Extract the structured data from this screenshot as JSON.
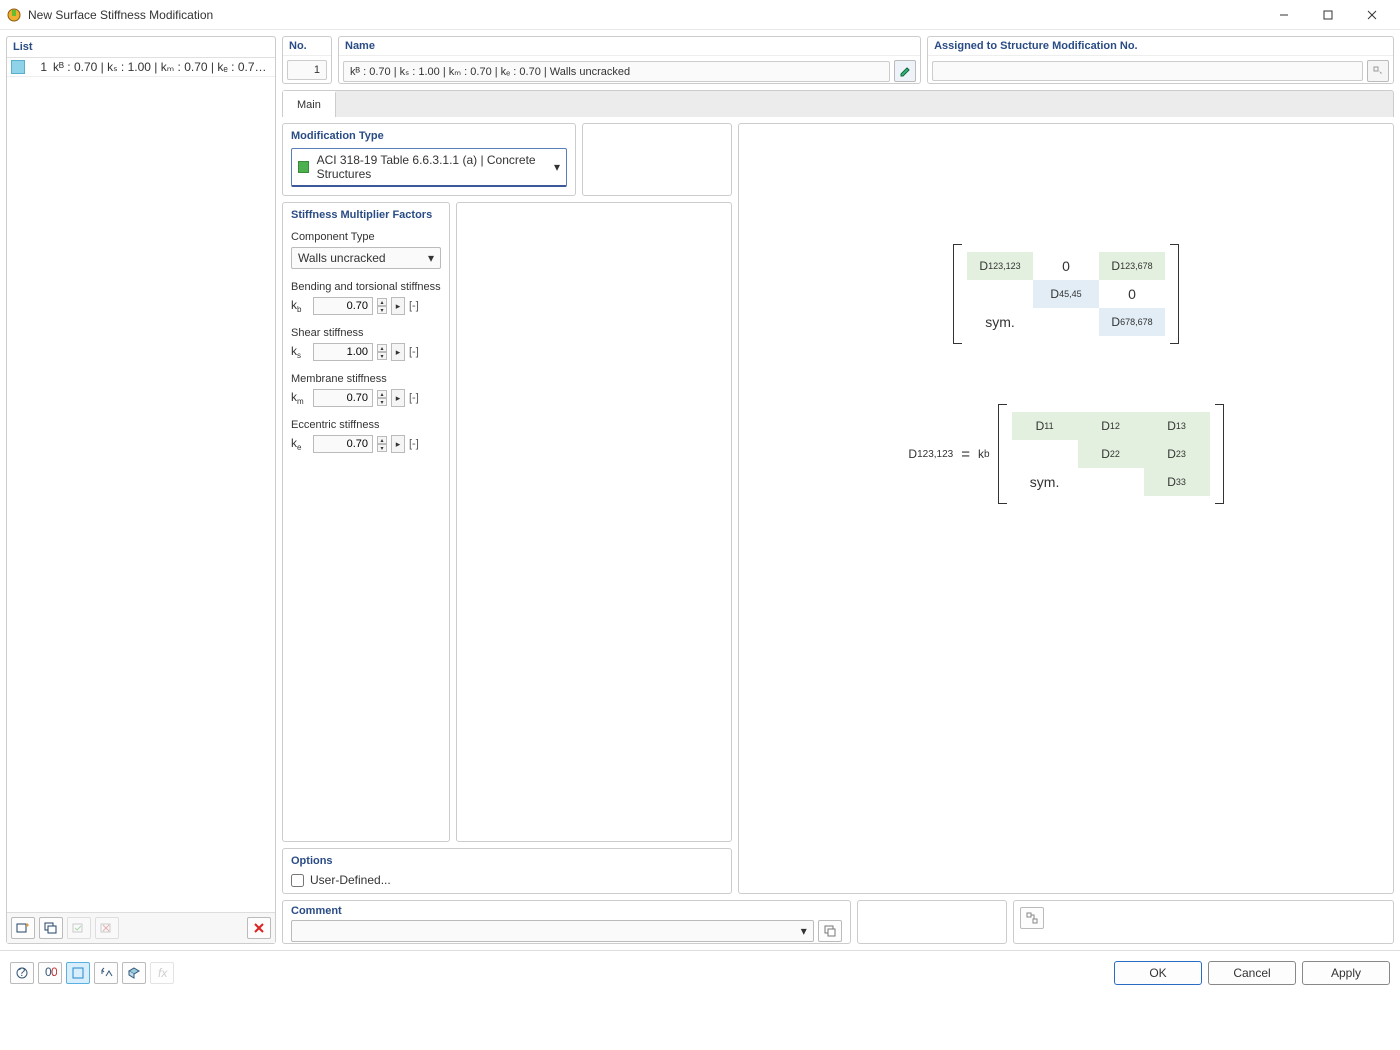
{
  "window": {
    "title": "New Surface Stiffness Modification"
  },
  "list": {
    "header": "List",
    "items": [
      {
        "num": "1",
        "text": "kᴮ : 0.70 | kₛ : 1.00 | kₘ : 0.70 | kₑ : 0.70 | Walls uncracked"
      }
    ]
  },
  "no": {
    "header": "No.",
    "value": "1"
  },
  "name": {
    "header": "Name",
    "value": "kᴮ : 0.70 | kₛ : 1.00 | kₘ : 0.70 | kₑ : 0.70 | Walls uncracked"
  },
  "assigned": {
    "header": "Assigned to Structure Modification No.",
    "value": ""
  },
  "tabs": {
    "main": "Main"
  },
  "modtype": {
    "header": "Modification Type",
    "value": "ACI 318-19 Table 6.6.3.1.1 (a) | Concrete Structures"
  },
  "factors": {
    "header": "Stiffness Multiplier Factors",
    "component_label": "Component Type",
    "component_value": "Walls uncracked",
    "bending_label": "Bending and torsional stiffness",
    "shear_label": "Shear stiffness",
    "membrane_label": "Membrane stiffness",
    "eccentric_label": "Eccentric stiffness",
    "kb_sym": "k",
    "kb_sub": "b",
    "kb_val": "0.70",
    "ks_sym": "k",
    "ks_sub": "s",
    "ks_val": "1.00",
    "km_sym": "k",
    "km_sub": "m",
    "km_val": "0.70",
    "ke_sym": "k",
    "ke_sub": "e",
    "ke_val": "0.70",
    "unit": "[-]"
  },
  "options": {
    "header": "Options",
    "userdef": "User-Defined..."
  },
  "comment": {
    "header": "Comment",
    "value": ""
  },
  "buttons": {
    "ok": "OK",
    "cancel": "Cancel",
    "apply": "Apply"
  },
  "matrix1": {
    "r0c0": "D",
    "r0c0s": "123,123",
    "r0c1": "0",
    "r0c2": "D",
    "r0c2s": "123,678",
    "r1c1": "D",
    "r1c1s": "45,45",
    "r1c2": "0",
    "r2c0": "sym.",
    "r2c2": "D",
    "r2c2s": "678,678"
  },
  "matrix2": {
    "lhs": "D",
    "lhs_s": "123,123",
    "eq": "=",
    "fac": "k",
    "fac_s": "b",
    "r0c0": "D",
    "r0c0s": "11",
    "r0c1": "D",
    "r0c1s": "12",
    "r0c2": "D",
    "r0c2s": "13",
    "r1c1": "D",
    "r1c1s": "22",
    "r1c2": "D",
    "r1c2s": "23",
    "r2c0": "sym.",
    "r2c2": "D",
    "r2c2s": "33"
  }
}
